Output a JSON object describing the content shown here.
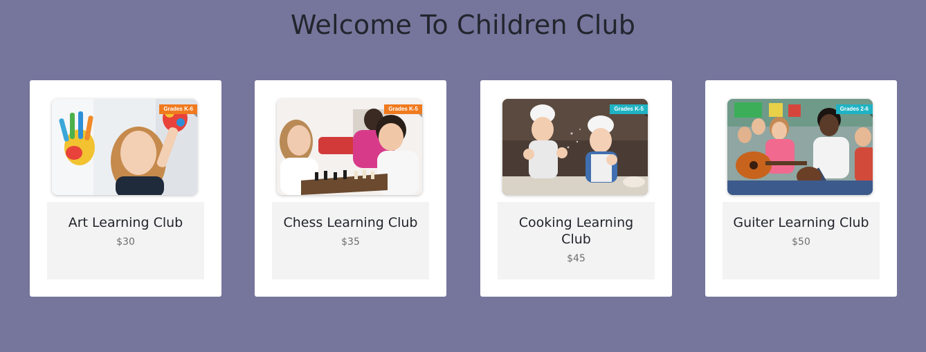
{
  "page": {
    "title": "Welcome To Children Club",
    "background": "#76759c"
  },
  "clubs": [
    {
      "name": "Art Learning Club",
      "price": "$30",
      "grade": "Grades K-6",
      "grade_color": "#f07a1e",
      "photo_icon": "art-photo"
    },
    {
      "name": "Chess Learning Club",
      "price": "$35",
      "grade": "Grades K-5",
      "grade_color": "#f07a1e",
      "photo_icon": "chess-photo"
    },
    {
      "name": "Cooking Learning Club",
      "price": "$45",
      "grade": "Grades K-5",
      "grade_color": "#1fb3c4",
      "photo_icon": "cooking-photo"
    },
    {
      "name": "Guiter Learning Club",
      "price": "$50",
      "grade": "Grades 2-6",
      "grade_color": "#1fb3c4",
      "photo_icon": "guitar-photo"
    }
  ]
}
